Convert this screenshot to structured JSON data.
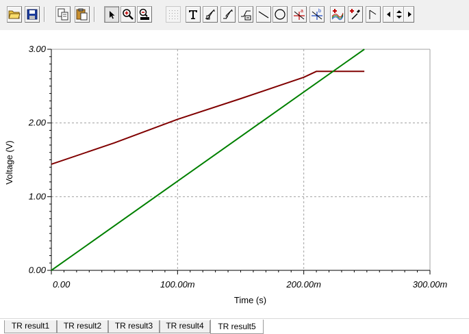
{
  "toolbar": {
    "buttons": [
      {
        "name": "open-folder-icon"
      },
      {
        "name": "save-disk-icon"
      },
      {
        "name": "copy-icon"
      },
      {
        "name": "paste-icon"
      },
      {
        "name": "select-pointer-icon"
      },
      {
        "name": "zoom-in-icon"
      },
      {
        "name": "zoom-100-icon"
      },
      {
        "name": "grid-icon"
      },
      {
        "name": "text-tool-icon"
      },
      {
        "name": "cursor-a-icon"
      },
      {
        "name": "cursor-b-icon"
      },
      {
        "name": "cursor-diff-icon"
      },
      {
        "name": "line-tool-icon"
      },
      {
        "name": "ellipse-tool-icon"
      },
      {
        "name": "marker-a-icon"
      },
      {
        "name": "marker-b-icon"
      },
      {
        "name": "add-curve-icon"
      },
      {
        "name": "probe-add-icon"
      },
      {
        "name": "flag-icon"
      },
      {
        "name": "nav-left-icon"
      },
      {
        "name": "nav-updown-icon"
      },
      {
        "name": "nav-right-icon"
      }
    ]
  },
  "chart_data": {
    "type": "line",
    "xlabel": "Time (s)",
    "ylabel": "Voltage (V)",
    "xlim": [
      0,
      0.3
    ],
    "ylim": [
      0,
      3
    ],
    "x_ticks": [
      "0.00",
      "100.00m",
      "200.00m",
      "300.00m"
    ],
    "y_ticks": [
      "0.00",
      "1.00",
      "2.00",
      "3.00"
    ],
    "grid": true,
    "series": [
      {
        "color": "#800000",
        "x": [
          0,
          0.05,
          0.1,
          0.15,
          0.2,
          0.21,
          0.22,
          0.248
        ],
        "y": [
          1.44,
          1.73,
          2.05,
          2.33,
          2.62,
          2.7,
          2.7,
          2.7
        ]
      },
      {
        "color": "#008000",
        "x": [
          0,
          0.1,
          0.2,
          0.248
        ],
        "y": [
          0,
          1.21,
          2.42,
          3.0
        ]
      }
    ]
  },
  "tabs": [
    {
      "label": "TR result1",
      "active": false
    },
    {
      "label": "TR result2",
      "active": false
    },
    {
      "label": "TR result3",
      "active": false
    },
    {
      "label": "TR result4",
      "active": false
    },
    {
      "label": "TR result5",
      "active": true
    }
  ],
  "colors": {
    "grid": "#a0a0a0",
    "axis": "#000000",
    "background": "#ffffff"
  }
}
